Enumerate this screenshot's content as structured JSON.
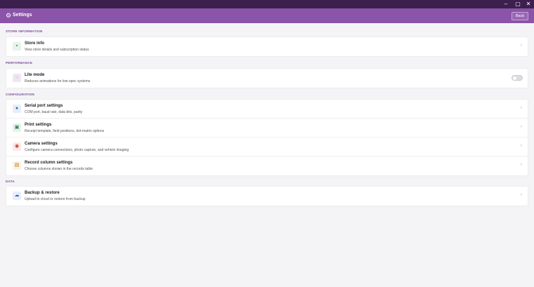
{
  "window": {
    "minimize": "–",
    "maximize": "▢",
    "close": "✕"
  },
  "header": {
    "title": "Settings",
    "back_label": "Back"
  },
  "sections": {
    "store": {
      "label": "STORE INFORMATION",
      "items": [
        {
          "title": "Store info",
          "subtitle": "View store details and subscription status",
          "icon": "store-icon"
        }
      ]
    },
    "performance": {
      "label": "PERFORMANCE",
      "items": [
        {
          "title": "Lite mode",
          "subtitle": "Reduces animations for low-spec systems",
          "icon": "lite-mode-icon",
          "toggle_on": false
        }
      ]
    },
    "configuration": {
      "label": "CONFIGURATION",
      "items": [
        {
          "title": "Serial port settings",
          "subtitle": "COM port, baud rate, data bits, parity",
          "icon": "serial-port-icon"
        },
        {
          "title": "Print settings",
          "subtitle": "Receipt template, field positions, dot-matrix options",
          "icon": "printer-icon"
        },
        {
          "title": "Camera settings",
          "subtitle": "Configure camera connections, photo capture, and vehicle imaging",
          "icon": "camera-icon"
        },
        {
          "title": "Record column settings",
          "subtitle": "Choose columns shown in the records table",
          "icon": "columns-icon"
        }
      ]
    },
    "data": {
      "label": "DATA",
      "items": [
        {
          "title": "Backup & restore",
          "subtitle": "Upload to cloud or restore from backup",
          "icon": "cloud-backup-icon"
        }
      ]
    }
  },
  "colors": {
    "accent": "#8a54a8",
    "titlebar": "#3d1f4e",
    "green": "#2e7d4f",
    "purple": "#7d4d9a",
    "blue": "#2f6fb0",
    "red": "#c0392b",
    "amber": "#b7791f"
  }
}
